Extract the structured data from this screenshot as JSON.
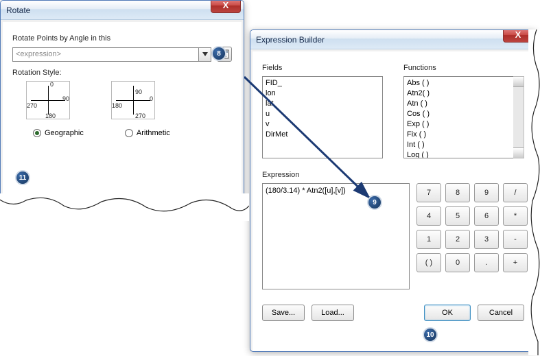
{
  "rotate": {
    "title": "Rotate",
    "label_angle": "Rotate Points by Angle in this",
    "expression_placeholder": "<expression>",
    "label_style": "Rotation Style:",
    "geo_axis": {
      "top": "0",
      "right": "90",
      "bottom": "180",
      "left": "270"
    },
    "arith_axis": {
      "top": "90",
      "right": "0",
      "bottom": "270",
      "left": "180"
    },
    "opt_geographic": "Geographic",
    "opt_arithmetic": "Arithmetic"
  },
  "expr": {
    "title": "Expression Builder",
    "label_fields": "Fields",
    "label_functions": "Functions",
    "fields": [
      "FID_",
      "lon",
      "lat",
      "u",
      "v",
      "DirMet"
    ],
    "functions": [
      "Abs (  )",
      "Atn2(  )",
      "Atn  (  )",
      "Cos (  )",
      "Exp (  )",
      "Fix  (  )",
      "Int  (  )",
      "Log (  )"
    ],
    "label_expression": "Expression",
    "expression_value": "(180/3.14) * Atn2([u],[v])",
    "keys": [
      "7",
      "8",
      "9",
      "/",
      "4",
      "5",
      "6",
      "*",
      "1",
      "2",
      "3",
      "-",
      "( )",
      "0",
      ".",
      "+"
    ],
    "btn_save": "Save...",
    "btn_load": "Load...",
    "btn_ok": "OK",
    "btn_cancel": "Cancel"
  },
  "badges": {
    "b8": "8",
    "b9": "9",
    "b10": "10",
    "b11": "11"
  }
}
